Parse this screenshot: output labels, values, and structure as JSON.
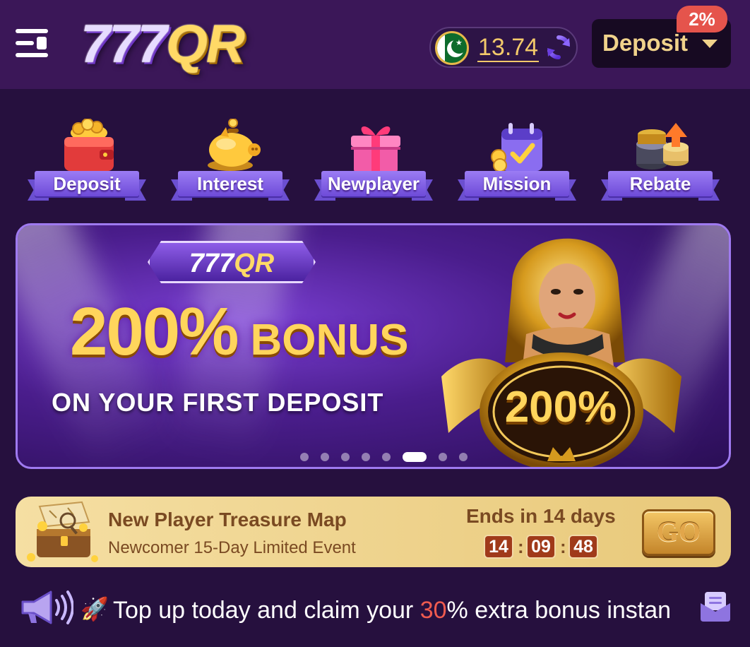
{
  "header": {
    "logo_main": "777",
    "logo_accent": "QR",
    "balance": "13.74",
    "deposit_label": "Deposit",
    "deposit_badge": "2%"
  },
  "quick_nav": [
    {
      "label": "Deposit",
      "icon": "red-wallet-coins-icon"
    },
    {
      "label": "Interest",
      "icon": "piggy-bank-icon"
    },
    {
      "label": "Newplayer",
      "icon": "gift-box-icon"
    },
    {
      "label": "Mission",
      "icon": "calendar-check-icon"
    },
    {
      "label": "Rebate",
      "icon": "chip-stack-arrow-icon"
    }
  ],
  "banner": {
    "logo_main": "777",
    "logo_accent": "QR",
    "headline_big": "200%",
    "headline_small": "BONUS",
    "subline": "ON YOUR FIRST DEPOSIT",
    "medal_text": "200%",
    "slide_count": 8,
    "active_slide": 6
  },
  "treasure": {
    "title": "New Player Treasure Map",
    "subtitle": "Newcomer 15-Day Limited Event",
    "ends": "Ends in 14 days",
    "timer": {
      "hours": "14",
      "minutes": "09",
      "seconds": "48"
    },
    "go_label": "GO"
  },
  "marquee": {
    "prefix": "Top up today and claim your ",
    "highlight": "30",
    "suffix": "% extra bonus instan"
  },
  "colors": {
    "header_bg": "#3b1758",
    "page_bg": "#26103e",
    "gold": "#f0d28b",
    "badge_red": "#e5544c",
    "ribbon_purple": "#7d5ce4",
    "highlight_red": "#ef5b4f"
  }
}
